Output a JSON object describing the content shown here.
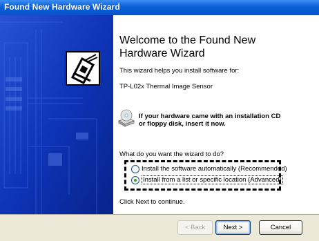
{
  "window": {
    "title": "Found New Hardware Wizard"
  },
  "content": {
    "heading_line1": "Welcome to the Found New",
    "heading_line2": "Hardware Wizard",
    "intro": "This wizard helps you install software for:",
    "device_name": "TP-L02x Thermal Image Sensor",
    "cd_prompt_line1": "If your hardware came with an installation CD",
    "cd_prompt_line2": "or floppy disk, insert it now.",
    "question": "What do you want the wizard to do?",
    "options": [
      {
        "label": "Install the software automatically (Recommended)",
        "selected": false
      },
      {
        "label": "Install from a list or specific location (Advanced)",
        "selected": true
      }
    ],
    "continue_hint": "Click Next to continue."
  },
  "footer": {
    "back_label": "< Back",
    "next_label": "Next >",
    "cancel_label": "Cancel"
  },
  "colors": {
    "title_bar": "#0a5fd8",
    "side_panel": "#0b2eae",
    "footer_bg": "#ece9d8",
    "radio_dot": "#2fa52f"
  },
  "icons": [
    "hardware-board-icon",
    "cd-drive-icon"
  ]
}
